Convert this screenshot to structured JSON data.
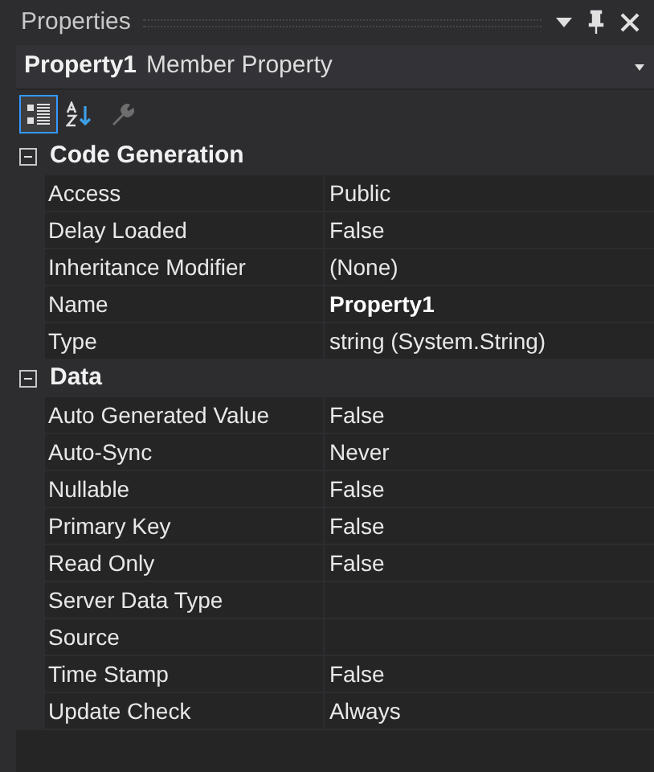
{
  "window": {
    "title": "Properties"
  },
  "object_selector": {
    "name": "Property1",
    "type": "Member Property"
  },
  "toolbar": [
    {
      "kind": "categorized",
      "selected": true,
      "disabled": false
    },
    {
      "kind": "alphabetical",
      "selected": false,
      "disabled": false
    },
    {
      "kind": "property_pages",
      "selected": false,
      "disabled": true
    }
  ],
  "categories": [
    {
      "name": "Code Generation",
      "expanded": true,
      "properties": [
        {
          "name": "Access",
          "value": "Public",
          "bold": false
        },
        {
          "name": "Delay Loaded",
          "value": "False",
          "bold": false
        },
        {
          "name": "Inheritance Modifier",
          "value": "(None)",
          "bold": false
        },
        {
          "name": "Name",
          "value": "Property1",
          "bold": true
        },
        {
          "name": "Type",
          "value": "string (System.String)",
          "bold": false
        }
      ]
    },
    {
      "name": "Data",
      "expanded": true,
      "properties": [
        {
          "name": "Auto Generated Value",
          "value": "False",
          "bold": false
        },
        {
          "name": "Auto-Sync",
          "value": "Never",
          "bold": false
        },
        {
          "name": "Nullable",
          "value": "False",
          "bold": false
        },
        {
          "name": "Primary Key",
          "value": "False",
          "bold": false
        },
        {
          "name": "Read Only",
          "value": "False",
          "bold": false
        },
        {
          "name": "Server Data Type",
          "bold": false
        },
        {
          "name": "Source",
          "bold": false
        },
        {
          "name": "Time Stamp",
          "value": "False",
          "bold": false
        },
        {
          "name": "Update Check",
          "value": "Always",
          "bold": false
        }
      ]
    }
  ]
}
